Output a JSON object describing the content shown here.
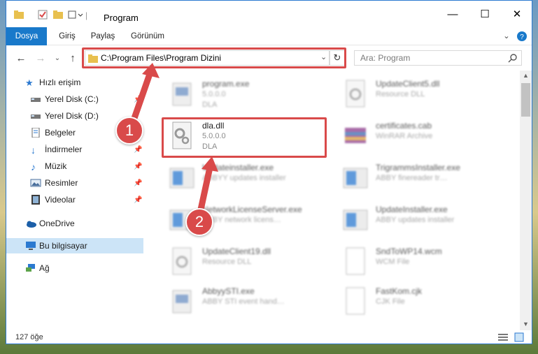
{
  "window": {
    "title": "Program",
    "controls": {
      "minimize": "—",
      "maximize": "☐",
      "close": "✕"
    }
  },
  "ribbon": {
    "tabs": [
      {
        "label": "Dosya",
        "active": true
      },
      {
        "label": "Giriş"
      },
      {
        "label": "Paylaş"
      },
      {
        "label": "Görünüm"
      }
    ]
  },
  "nav": {
    "address": "C:\\Program Files\\Program Dizini",
    "search_placeholder": "Ara: Program"
  },
  "sidebar": {
    "items": [
      {
        "label": "Hızlı erişim",
        "icon": "star-icon"
      },
      {
        "label": "Yerel Disk (C:)",
        "icon": "drive-icon"
      },
      {
        "label": "Yerel Disk (D:)",
        "icon": "drive-icon"
      },
      {
        "label": "Belgeler",
        "icon": "documents-icon"
      },
      {
        "label": "İndirmeler",
        "icon": "downloads-icon"
      },
      {
        "label": "Müzik",
        "icon": "music-icon"
      },
      {
        "label": "Resimler",
        "icon": "pictures-icon"
      },
      {
        "label": "Videolar",
        "icon": "videos-icon"
      },
      {
        "label": "OneDrive",
        "icon": "cloud-icon"
      },
      {
        "label": "Bu bilgisayar",
        "icon": "computer-icon",
        "selected": true
      },
      {
        "label": "Ağ",
        "icon": "network-icon"
      }
    ]
  },
  "files": [
    {
      "name": "program.exe",
      "line2": "5.0.0.0",
      "line3": "DLA",
      "icon": "exe-icon",
      "blurred": true
    },
    {
      "name": "UpdateClient5.dll",
      "line2": "Resource DLL",
      "line3": "",
      "icon": "dll-icon",
      "blurred": true
    },
    {
      "name": "dla.dll",
      "line2": "5.0.0.0",
      "line3": "DLA",
      "icon": "dll-icon",
      "blurred": false
    },
    {
      "name": "certificates.cab",
      "line2": "WinRAR Archive",
      "line3": "",
      "icon": "archive-icon",
      "blurred": true
    },
    {
      "name": "Updateinstaller.exe",
      "line2": "ABBYY updates installer",
      "line3": "",
      "icon": "installer-icon",
      "blurred": true
    },
    {
      "name": "TrigrammsInstaller.exe",
      "line2": "ABBY finereader tr…",
      "line3": "",
      "icon": "installer-icon",
      "blurred": true
    },
    {
      "name": "NetworkLicenseServer.exe",
      "line2": "ABBY network licens…",
      "line3": "",
      "icon": "installer-icon",
      "blurred": true
    },
    {
      "name": "UpdateInstaller.exe",
      "line2": "ABBY updates installer",
      "line3": "",
      "icon": "installer-icon",
      "blurred": true
    },
    {
      "name": "UpdateClient19.dll",
      "line2": "Resource DLL",
      "line3": "",
      "icon": "dll-icon",
      "blurred": true
    },
    {
      "name": "SndToWP14.wcm",
      "line2": "WCM File",
      "line3": "",
      "icon": "file-icon",
      "blurred": true
    },
    {
      "name": "AbbyySTI.exe",
      "line2": "ABBY STI event hand…",
      "line3": "",
      "icon": "exe-icon",
      "blurred": true
    },
    {
      "name": "FastKom.cjk",
      "line2": "CJK File",
      "line3": "",
      "icon": "file-icon",
      "blurred": true
    }
  ],
  "status": {
    "count": "127 öğe"
  },
  "callouts": [
    "1",
    "2"
  ],
  "colors": {
    "accent": "#1979ca",
    "highlight": "#d94a4a",
    "selected": "#cce4f7"
  }
}
